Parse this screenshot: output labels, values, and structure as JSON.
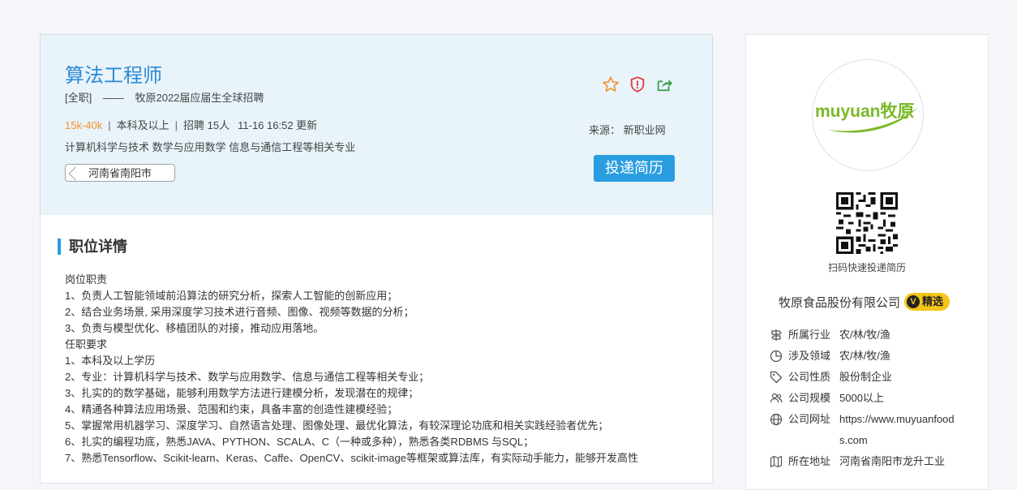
{
  "job": {
    "title": "算法工程师",
    "type": "[全职]",
    "dash": "——",
    "recruit_name": "牧原2022届应届生全球招聘",
    "salary": "15k-40k",
    "education": "本科及以上",
    "headcount": "招聘 15人",
    "updated": "11-16 16:52 更新",
    "majors": "计算机科学与技术 数学与应用数学 信息与通信工程等相关专业",
    "location": "河南省南阳市",
    "source": "来源： 新职业网",
    "apply_label": "投递简历",
    "colors": {
      "title": "#2a8ad4",
      "salary": "#f5922b",
      "apply": "#2a9de0"
    }
  },
  "detail": {
    "section_title": "职位详情",
    "lines": [
      "岗位职责",
      "1、负责人工智能领域前沿算法的研究分析，探索人工智能的创新应用；",
      "2、结合业务场景, 采用深度学习技术进行音频、图像、视频等数据的分析；",
      "3、负责与模型优化、移植团队的对接，推动应用落地。",
      "任职要求",
      "1、本科及以上学历",
      "2、专业：计算机科学与技术、数学与应用数学、信息与通信工程等相关专业；",
      "3、扎实的的数学基础，能够利用数学方法进行建模分析，发现潜在的规律；",
      "4、精通各种算法应用场景、范围和约束，具备丰富的创造性建模经验；",
      "5、掌握常用机器学习、深度学习、自然语言处理、图像处理、最优化算法，有较深理论功底和相关实践经验者优先；",
      "6、扎实的编程功底，熟悉JAVA、PYTHON、SCALA、C（一种或多种），熟悉各类RDBMS 与SQL；",
      "7、熟悉Tensorflow、Scikit-learn、Keras、Caffe、OpenCV、scikit-image等框架或算法库，有实际动手能力，能够开发高性"
    ]
  },
  "company": {
    "logo_text": "muyuan牧原",
    "qr_caption": "扫码快速投递简历",
    "name": "牧原食品股份有限公司",
    "badge_mark": "V",
    "badge_label": "精选",
    "info": [
      {
        "icon": "signpost-icon",
        "label": "所属行业",
        "value": "农/林/牧/渔"
      },
      {
        "icon": "pie-icon",
        "label": "涉及领域",
        "value": "农/林/牧/渔"
      },
      {
        "icon": "tag-icon",
        "label": "公司性质",
        "value": "股份制企业"
      },
      {
        "icon": "people-icon",
        "label": "公司规模",
        "value": "5000以上"
      },
      {
        "icon": "globe-icon",
        "label": "公司网址",
        "value": "https://www.muyuanfoods.com"
      },
      {
        "icon": "map-icon",
        "label": "所在地址",
        "value": "河南省南阳市龙升工业"
      }
    ],
    "colors": {
      "logo_green": "#7ab827",
      "badge": "#f5c518"
    }
  }
}
